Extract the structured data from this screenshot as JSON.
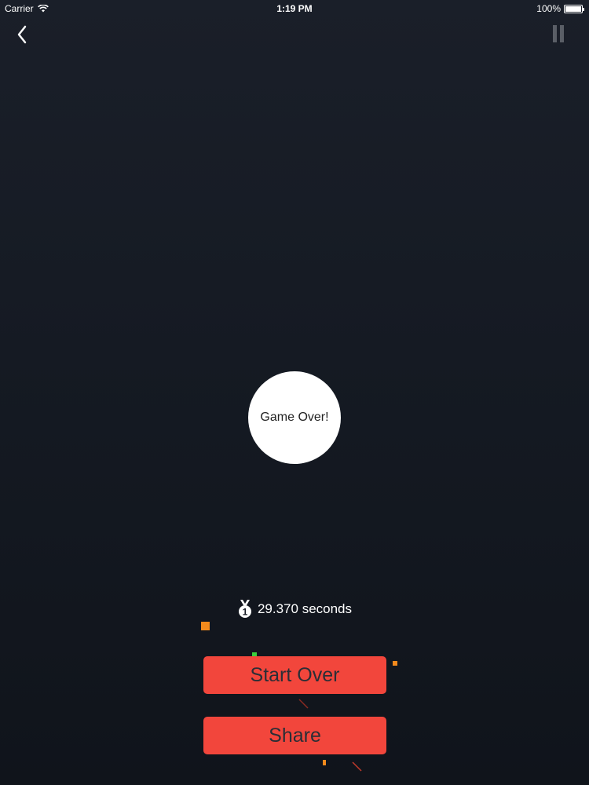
{
  "status_bar": {
    "carrier": "Carrier",
    "time": "1:19 PM",
    "battery": "100%",
    "battery_level": 1.0
  },
  "nav": {
    "back_icon": "chevron-left-icon",
    "pause_icon": "pause-icon"
  },
  "game": {
    "game_over_label": "Game Over!",
    "score_text": "29.370 seconds",
    "medal_icon": "medal-icon",
    "medal_number": "1"
  },
  "buttons": {
    "start_over_label": "Start Over",
    "share_label": "Share"
  },
  "colors": {
    "background_top": "#1a1f29",
    "background_bottom": "#10141b",
    "button_red": "#f2463c",
    "particle_orange": "#f28a1c",
    "particle_green": "#3ccf3c"
  }
}
